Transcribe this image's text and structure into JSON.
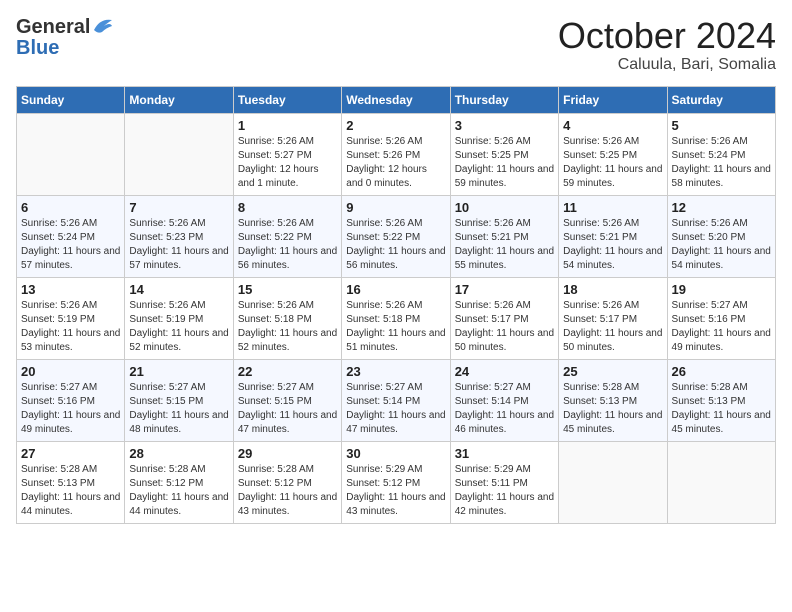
{
  "logo": {
    "general": "General",
    "blue": "Blue"
  },
  "title": {
    "month": "October 2024",
    "location": "Caluula, Bari, Somalia"
  },
  "weekdays": [
    "Sunday",
    "Monday",
    "Tuesday",
    "Wednesday",
    "Thursday",
    "Friday",
    "Saturday"
  ],
  "weeks": [
    [
      {
        "day": "",
        "sunrise": "",
        "sunset": "",
        "daylight": ""
      },
      {
        "day": "",
        "sunrise": "",
        "sunset": "",
        "daylight": ""
      },
      {
        "day": "1",
        "sunrise": "Sunrise: 5:26 AM",
        "sunset": "Sunset: 5:27 PM",
        "daylight": "Daylight: 12 hours and 1 minute."
      },
      {
        "day": "2",
        "sunrise": "Sunrise: 5:26 AM",
        "sunset": "Sunset: 5:26 PM",
        "daylight": "Daylight: 12 hours and 0 minutes."
      },
      {
        "day": "3",
        "sunrise": "Sunrise: 5:26 AM",
        "sunset": "Sunset: 5:25 PM",
        "daylight": "Daylight: 11 hours and 59 minutes."
      },
      {
        "day": "4",
        "sunrise": "Sunrise: 5:26 AM",
        "sunset": "Sunset: 5:25 PM",
        "daylight": "Daylight: 11 hours and 59 minutes."
      },
      {
        "day": "5",
        "sunrise": "Sunrise: 5:26 AM",
        "sunset": "Sunset: 5:24 PM",
        "daylight": "Daylight: 11 hours and 58 minutes."
      }
    ],
    [
      {
        "day": "6",
        "sunrise": "Sunrise: 5:26 AM",
        "sunset": "Sunset: 5:24 PM",
        "daylight": "Daylight: 11 hours and 57 minutes."
      },
      {
        "day": "7",
        "sunrise": "Sunrise: 5:26 AM",
        "sunset": "Sunset: 5:23 PM",
        "daylight": "Daylight: 11 hours and 57 minutes."
      },
      {
        "day": "8",
        "sunrise": "Sunrise: 5:26 AM",
        "sunset": "Sunset: 5:22 PM",
        "daylight": "Daylight: 11 hours and 56 minutes."
      },
      {
        "day": "9",
        "sunrise": "Sunrise: 5:26 AM",
        "sunset": "Sunset: 5:22 PM",
        "daylight": "Daylight: 11 hours and 56 minutes."
      },
      {
        "day": "10",
        "sunrise": "Sunrise: 5:26 AM",
        "sunset": "Sunset: 5:21 PM",
        "daylight": "Daylight: 11 hours and 55 minutes."
      },
      {
        "day": "11",
        "sunrise": "Sunrise: 5:26 AM",
        "sunset": "Sunset: 5:21 PM",
        "daylight": "Daylight: 11 hours and 54 minutes."
      },
      {
        "day": "12",
        "sunrise": "Sunrise: 5:26 AM",
        "sunset": "Sunset: 5:20 PM",
        "daylight": "Daylight: 11 hours and 54 minutes."
      }
    ],
    [
      {
        "day": "13",
        "sunrise": "Sunrise: 5:26 AM",
        "sunset": "Sunset: 5:19 PM",
        "daylight": "Daylight: 11 hours and 53 minutes."
      },
      {
        "day": "14",
        "sunrise": "Sunrise: 5:26 AM",
        "sunset": "Sunset: 5:19 PM",
        "daylight": "Daylight: 11 hours and 52 minutes."
      },
      {
        "day": "15",
        "sunrise": "Sunrise: 5:26 AM",
        "sunset": "Sunset: 5:18 PM",
        "daylight": "Daylight: 11 hours and 52 minutes."
      },
      {
        "day": "16",
        "sunrise": "Sunrise: 5:26 AM",
        "sunset": "Sunset: 5:18 PM",
        "daylight": "Daylight: 11 hours and 51 minutes."
      },
      {
        "day": "17",
        "sunrise": "Sunrise: 5:26 AM",
        "sunset": "Sunset: 5:17 PM",
        "daylight": "Daylight: 11 hours and 50 minutes."
      },
      {
        "day": "18",
        "sunrise": "Sunrise: 5:26 AM",
        "sunset": "Sunset: 5:17 PM",
        "daylight": "Daylight: 11 hours and 50 minutes."
      },
      {
        "day": "19",
        "sunrise": "Sunrise: 5:27 AM",
        "sunset": "Sunset: 5:16 PM",
        "daylight": "Daylight: 11 hours and 49 minutes."
      }
    ],
    [
      {
        "day": "20",
        "sunrise": "Sunrise: 5:27 AM",
        "sunset": "Sunset: 5:16 PM",
        "daylight": "Daylight: 11 hours and 49 minutes."
      },
      {
        "day": "21",
        "sunrise": "Sunrise: 5:27 AM",
        "sunset": "Sunset: 5:15 PM",
        "daylight": "Daylight: 11 hours and 48 minutes."
      },
      {
        "day": "22",
        "sunrise": "Sunrise: 5:27 AM",
        "sunset": "Sunset: 5:15 PM",
        "daylight": "Daylight: 11 hours and 47 minutes."
      },
      {
        "day": "23",
        "sunrise": "Sunrise: 5:27 AM",
        "sunset": "Sunset: 5:14 PM",
        "daylight": "Daylight: 11 hours and 47 minutes."
      },
      {
        "day": "24",
        "sunrise": "Sunrise: 5:27 AM",
        "sunset": "Sunset: 5:14 PM",
        "daylight": "Daylight: 11 hours and 46 minutes."
      },
      {
        "day": "25",
        "sunrise": "Sunrise: 5:28 AM",
        "sunset": "Sunset: 5:13 PM",
        "daylight": "Daylight: 11 hours and 45 minutes."
      },
      {
        "day": "26",
        "sunrise": "Sunrise: 5:28 AM",
        "sunset": "Sunset: 5:13 PM",
        "daylight": "Daylight: 11 hours and 45 minutes."
      }
    ],
    [
      {
        "day": "27",
        "sunrise": "Sunrise: 5:28 AM",
        "sunset": "Sunset: 5:13 PM",
        "daylight": "Daylight: 11 hours and 44 minutes."
      },
      {
        "day": "28",
        "sunrise": "Sunrise: 5:28 AM",
        "sunset": "Sunset: 5:12 PM",
        "daylight": "Daylight: 11 hours and 44 minutes."
      },
      {
        "day": "29",
        "sunrise": "Sunrise: 5:28 AM",
        "sunset": "Sunset: 5:12 PM",
        "daylight": "Daylight: 11 hours and 43 minutes."
      },
      {
        "day": "30",
        "sunrise": "Sunrise: 5:29 AM",
        "sunset": "Sunset: 5:12 PM",
        "daylight": "Daylight: 11 hours and 43 minutes."
      },
      {
        "day": "31",
        "sunrise": "Sunrise: 5:29 AM",
        "sunset": "Sunset: 5:11 PM",
        "daylight": "Daylight: 11 hours and 42 minutes."
      },
      {
        "day": "",
        "sunrise": "",
        "sunset": "",
        "daylight": ""
      },
      {
        "day": "",
        "sunrise": "",
        "sunset": "",
        "daylight": ""
      }
    ]
  ]
}
